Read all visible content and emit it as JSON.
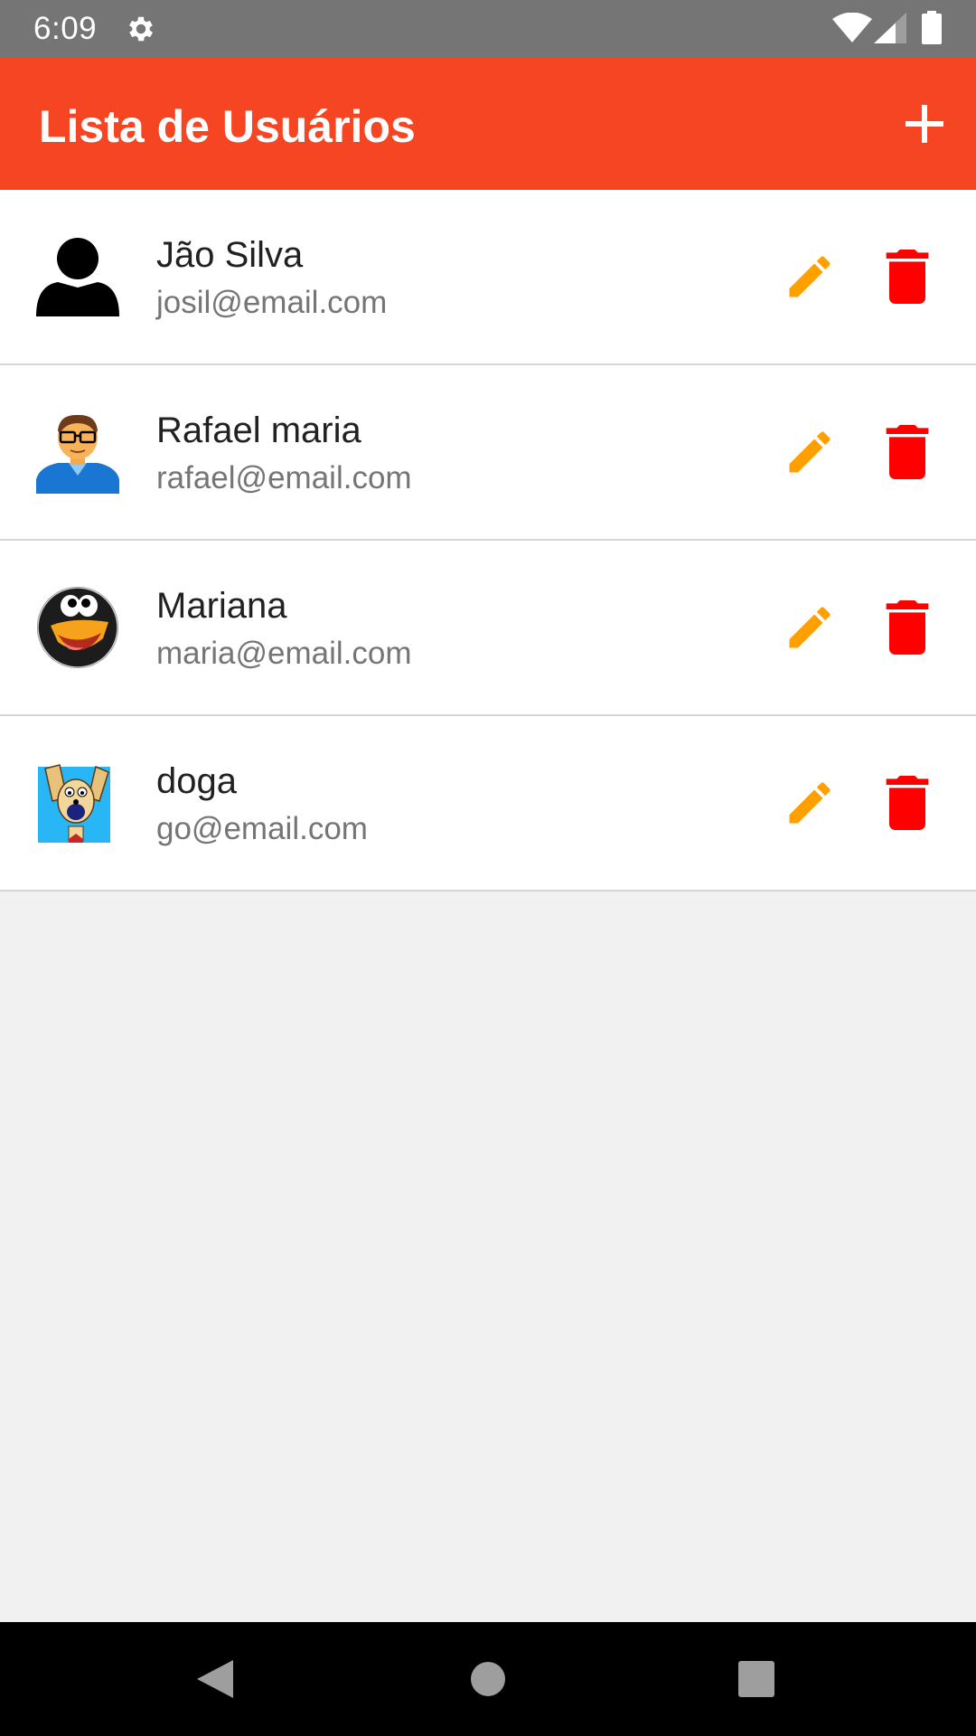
{
  "status_bar": {
    "time": "6:09",
    "icons": [
      "gear-icon",
      "wifi-icon",
      "signal-icon",
      "battery-icon"
    ]
  },
  "app_bar": {
    "title": "Lista de Usuários",
    "add_icon": "plus-icon",
    "background": "#f64522"
  },
  "users": [
    {
      "name": "Jão Silva",
      "email": "josil@email.com",
      "avatar": "person-silhouette"
    },
    {
      "name": "Rafael maria",
      "email": "rafael@email.com",
      "avatar": "man-with-glasses"
    },
    {
      "name": "Mariana",
      "email": "maria@email.com",
      "avatar": "penguin"
    },
    {
      "name": "doga",
      "email": "go@email.com",
      "avatar": "cartoon-dog"
    }
  ],
  "colors": {
    "edit": "#ffa000",
    "delete": "#ff0000",
    "list_background": "#f1f1f1",
    "name_text": "#212121",
    "email_text": "#757575"
  },
  "nav_bar": {
    "icons": [
      "back-icon",
      "home-icon",
      "recents-icon"
    ]
  }
}
